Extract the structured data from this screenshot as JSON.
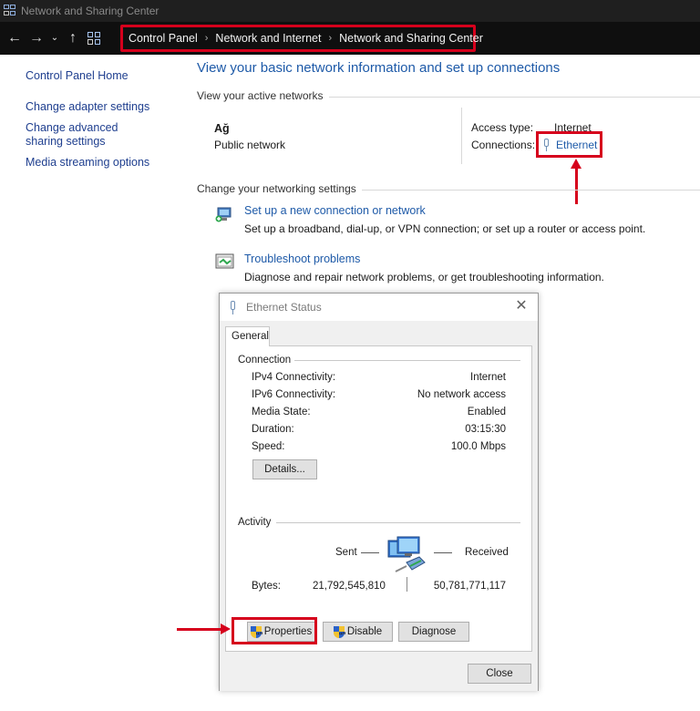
{
  "window": {
    "title": "Network and Sharing Center",
    "app_icon": "network-center-icon"
  },
  "address_bar": {
    "back_icon": "back-arrow-icon",
    "forward_icon": "forward-arrow-icon",
    "history_icon": "chevron-down-icon",
    "up_icon": "up-arrow-icon",
    "breadcrumbs": [
      "Control Panel",
      "Network and Internet",
      "Network and Sharing Center"
    ],
    "highlight_color": "#d6001c"
  },
  "sidebar": {
    "items": [
      {
        "label": "Control Panel Home"
      },
      {
        "label": "Change adapter settings"
      },
      {
        "label": "Change advanced sharing settings"
      },
      {
        "label": "Media streaming options"
      }
    ]
  },
  "main": {
    "title": "View your basic network information and set up connections",
    "active_networks_label": "View your active networks",
    "network": {
      "name": "Ağ",
      "type": "Public network",
      "access_type_label": "Access type:",
      "access_type_value": "Internet",
      "connections_label": "Connections:",
      "connection_link": "Ethernet"
    },
    "change_settings_label": "Change your networking settings",
    "tasks": [
      {
        "link": "Set up a new connection or network",
        "desc": "Set up a broadband, dial-up, or VPN connection; or set up a router or access point.",
        "icon": "new-connection-icon"
      },
      {
        "link": "Troubleshoot problems",
        "desc": "Diagnose and repair network problems, or get troubleshooting information.",
        "icon": "troubleshoot-icon"
      }
    ]
  },
  "dialog": {
    "title": "Ethernet Status",
    "tab": "General",
    "connection_group": "Connection",
    "rows": [
      {
        "label": "IPv4 Connectivity:",
        "value": "Internet"
      },
      {
        "label": "IPv6 Connectivity:",
        "value": "No network access"
      },
      {
        "label": "Media State:",
        "value": "Enabled"
      },
      {
        "label": "Duration:",
        "value": "03:15:30"
      },
      {
        "label": "Speed:",
        "value": "100.0 Mbps"
      }
    ],
    "details_button": "Details...",
    "activity_group": "Activity",
    "sent_label": "Sent",
    "received_label": "Received",
    "bytes_label": "Bytes:",
    "bytes_sent": "21,792,545,810",
    "bytes_received": "50,781,771,117",
    "properties_button": "Properties",
    "disable_button": "Disable",
    "diagnose_button": "Diagnose",
    "close_button": "Close"
  }
}
